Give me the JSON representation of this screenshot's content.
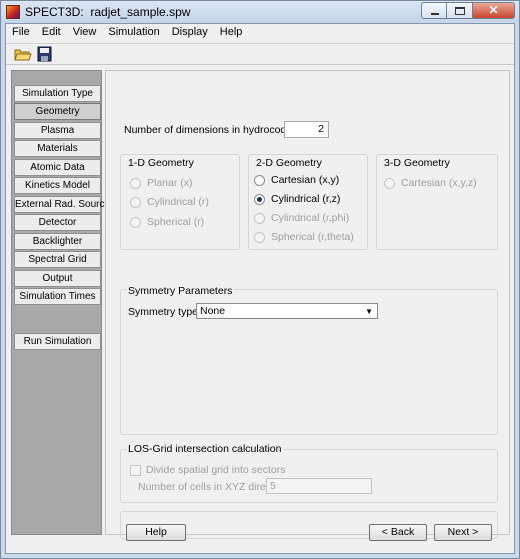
{
  "window": {
    "app_name": "SPECT3D:",
    "file_name": "radjet_sample.spw",
    "close_symbol": "✕"
  },
  "menu": {
    "file": "File",
    "edit": "Edit",
    "view": "View",
    "simulation": "Simulation",
    "display": "Display",
    "help": "Help"
  },
  "toolbar": {
    "open_icon": "folder-open-icon",
    "save_icon": "floppy-disk-icon"
  },
  "sidebar": {
    "items": [
      {
        "label": "Simulation Type"
      },
      {
        "label": "Geometry"
      },
      {
        "label": "Plasma"
      },
      {
        "label": "Materials"
      },
      {
        "label": "Atomic Data"
      },
      {
        "label": "Kinetics Model"
      },
      {
        "label": "External Rad. Source"
      },
      {
        "label": "Detector"
      },
      {
        "label": "Backlighter"
      },
      {
        "label": "Spectral Grid"
      },
      {
        "label": "Output"
      },
      {
        "label": "Simulation Times"
      }
    ],
    "active_index": 1,
    "run_label": "Run Simulation"
  },
  "geometry": {
    "dimensions_label": "Number of dimensions in hydrocode file:",
    "dimensions_value": "2",
    "group_1d": {
      "title": "1-D Geometry",
      "options": [
        "Planar (x)",
        "Cylindrical (r)",
        "Spherical (r)"
      ]
    },
    "group_2d": {
      "title": "2-D Geometry",
      "options": [
        "Cartesian (x,y)",
        "Cylindrical (r,z)",
        "Cylindrical (r,phi)",
        "Spherical (r,theta)"
      ],
      "selected_index": 1
    },
    "group_3d": {
      "title": "3-D Geometry",
      "options": [
        "Cartesian (x,y,z)"
      ]
    }
  },
  "symmetry": {
    "title": "Symmetry Parameters",
    "type_label": "Symmetry type:",
    "type_value": "None"
  },
  "los": {
    "title": "LOS-Grid intersection calculation",
    "divide_label": "Divide spatial grid  into sectors",
    "cells_label": "Number of cells in XYZ direction",
    "cells_value": "5"
  },
  "footer": {
    "help": "Help",
    "back": "< Back",
    "next": "Next >"
  },
  "colors": {
    "titlebar": "#c9d8ea",
    "panel": "#f0f0f0",
    "sidebar": "#a8a8a8",
    "disabled_text": "#9e9e9e"
  }
}
